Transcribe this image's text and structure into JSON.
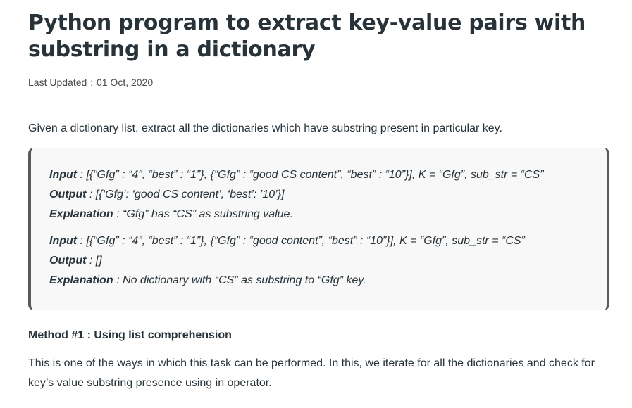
{
  "article": {
    "title": "Python program to extract key-value pairs with substring in a dictionary",
    "updated_label": "Last Updated",
    "updated_sep": ":",
    "updated_date": "01 Oct, 2020",
    "intro": "Given a dictionary list, extract all the dictionaries which have substring present in particular key."
  },
  "examples": [
    {
      "input_label": "Input",
      "input_text": ": [{“Gfg” : “4”, “best” : “1”}, {“Gfg” : “good CS content”, “best” : “10”}], K = “Gfg”, sub_str = “CS”",
      "output_label": "Output",
      "output_text": ": [{‘Gfg’: ‘good CS content’, ‘best’: ’10’}]",
      "explanation_label": "Explanation",
      "explanation_text": ": “Gfg” has “CS” as substring value."
    },
    {
      "input_label": "Input",
      "input_text": ": [{“Gfg” : “4”, “best” : “1”}, {“Gfg” : “good content”, “best” : “10”}], K = “Gfg”, sub_str = “CS”",
      "output_label": "Output",
      "output_text": ": []",
      "explanation_label": "Explanation",
      "explanation_text": ": No dictionary with “CS” as substring to “Gfg” key."
    }
  ],
  "method": {
    "heading": "Method #1 : Using list comprehension",
    "description": "This is one of the ways in which this task can be performed. In this, we iterate for all the dictionaries and check for key’s value substring presence using in operator."
  }
}
